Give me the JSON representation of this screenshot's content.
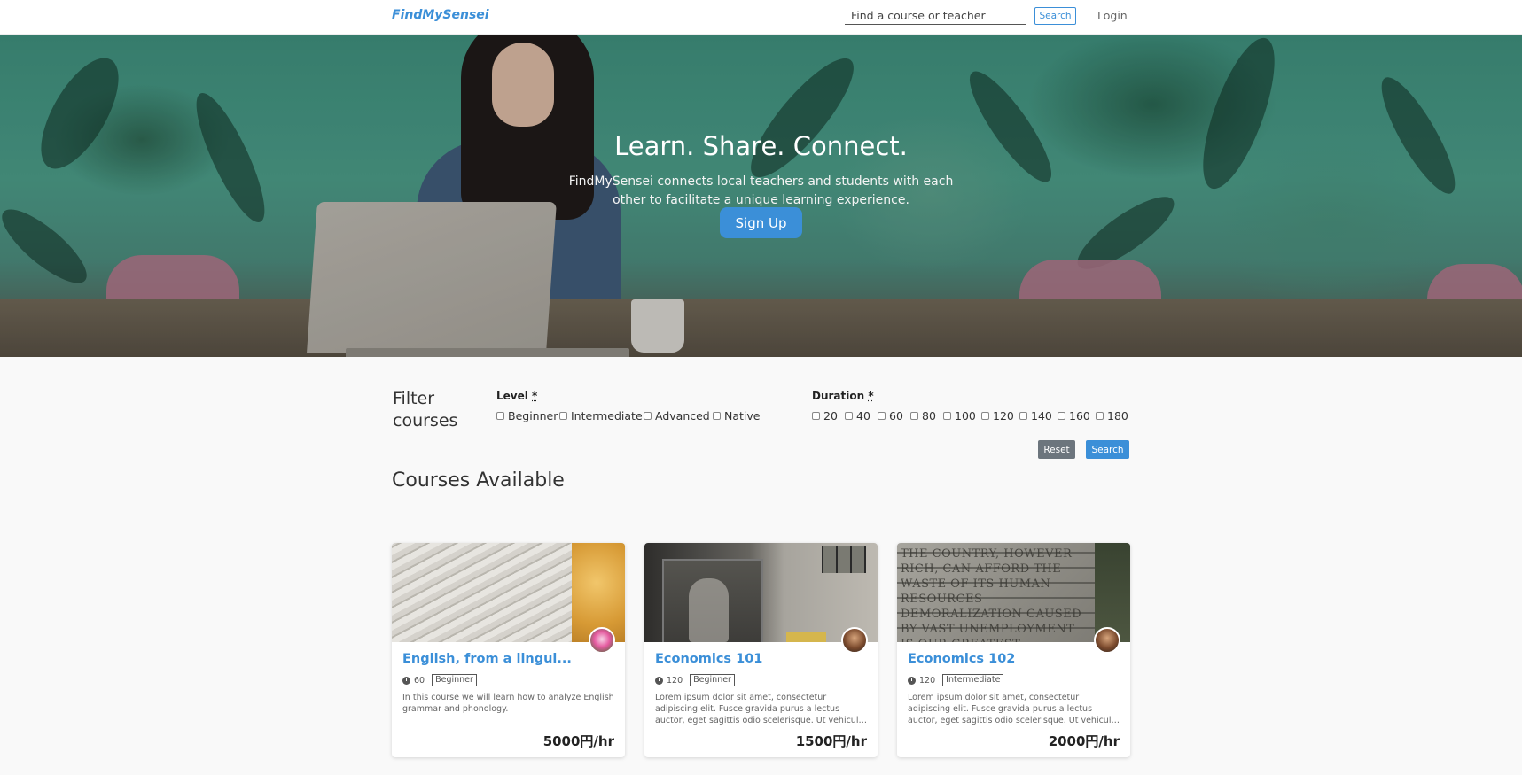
{
  "navbar": {
    "brand": "FindMySensei",
    "search_placeholder": "Find a course or teacher",
    "search_button": "Search",
    "login": "Login"
  },
  "hero": {
    "title": "Learn. Share. Connect.",
    "description": "FindMySensei connects local teachers and students with each other to facilitate a unique learning experience.",
    "signup_button": "Sign Up"
  },
  "filter": {
    "title": "Filter courses",
    "level": {
      "label": "Level",
      "required_marker": "*",
      "options": [
        "Beginner",
        "Intermediate",
        "Advanced",
        "Native"
      ]
    },
    "duration": {
      "label": "Duration",
      "required_marker": "*",
      "options": [
        "20",
        "40",
        "60",
        "80",
        "100",
        "120",
        "140",
        "160",
        "180"
      ]
    },
    "reset_button": "Reset",
    "search_button": "Search"
  },
  "courses": {
    "section_title": "Courses Available",
    "items": [
      {
        "title": "English, from a lingui...",
        "duration": "60",
        "level": "Beginner",
        "description": "In this course we will learn how to analyze English grammar and phonology.",
        "price": "5000円/hr",
        "image": "dictionary-page",
        "avatar": "flower-avatar"
      },
      {
        "title": "Economics 101",
        "duration": "120",
        "level": "Beginner",
        "description": "Lorem ipsum dolor sit amet, consectetur adipiscing elit. Fusce gravida purus a lectus auctor, eget sagittis odio scelerisque. Ut vehicula lectus sit ame...",
        "price": "1500円/hr",
        "image": "building-entrance",
        "avatar": "person-avatar"
      },
      {
        "title": "Economics 102",
        "duration": "120",
        "level": "Intermediate",
        "description": "Lorem ipsum dolor sit amet, consectetur adipiscing elit. Fusce gravida purus a lectus auctor, eget sagittis odio scelerisque. Ut vehicula lectus sit ame...",
        "price": "2000円/hr",
        "image": "stone-inscription",
        "image_text": "THE COUNTRY, HOWEVER RICH, CAN AFFORD THE WASTE OF ITS HUMAN RESOURCES DEMORALIZATION CAUSED BY VAST UNEMPLOYMENT IS OUR GREATEST EXTRAVAGANCE MORALLY IT IS THE GREATEST MENACE TO OUR SOCIAL ORDER",
        "avatar": "person-avatar"
      }
    ]
  },
  "colors": {
    "accent": "#3b8fd8",
    "reset_gray": "#6c757d",
    "page_bg": "#f9f9f9"
  }
}
